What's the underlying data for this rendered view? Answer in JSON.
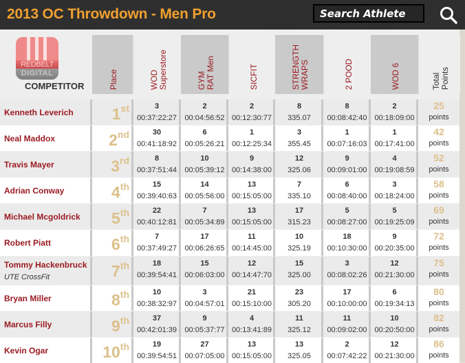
{
  "header": {
    "title": "2013 OC Throwdown - Men Pro",
    "search_placeholder": "Search Athlete",
    "search_icon": "magnifier-icon"
  },
  "logo": {
    "top_text": "REDBELT",
    "bottom_text": "DIGITAL",
    "label": "COMPETITOR"
  },
  "colors": {
    "title": "#f0a030",
    "athlete_name": "#9b1b22",
    "place_and_points": "#dcc08a"
  },
  "columns": [
    {
      "key": "place",
      "label": "Place"
    },
    {
      "key": "wod_superstore",
      "label": "WOD\nSuperstore"
    },
    {
      "key": "gym_rat_men",
      "label": "GYM\nRAT Men"
    },
    {
      "key": "sicfit",
      "label": "SICFIT"
    },
    {
      "key": "strength_wraps",
      "label": "STRENGTH\nWRAPS"
    },
    {
      "key": "two_pood",
      "label": "2 POOD"
    },
    {
      "key": "wod6",
      "label": "WOD 6"
    },
    {
      "key": "total",
      "label": "Total\nPoints"
    }
  ],
  "points_label": "points",
  "athletes": [
    {
      "name": "Kenneth Leverich",
      "affiliate": "",
      "place": "1",
      "suffix": "st",
      "events": [
        [
          "3",
          "00:37:22:27"
        ],
        [
          "2",
          "00:04:56:52"
        ],
        [
          "2",
          "00:12:30:77"
        ],
        [
          "8",
          "335.07"
        ],
        [
          "8",
          "00:08:42:40"
        ],
        [
          "2",
          "00:18:09:00"
        ]
      ],
      "total": "25"
    },
    {
      "name": "Neal Maddox",
      "affiliate": "",
      "place": "2",
      "suffix": "nd",
      "events": [
        [
          "30",
          "00:41:18:92"
        ],
        [
          "6",
          "00:05:26:21"
        ],
        [
          "1",
          "00:12:25:34"
        ],
        [
          "3",
          "355.45"
        ],
        [
          "1",
          "00:07:16:03"
        ],
        [
          "1",
          "00:17:41:00"
        ]
      ],
      "total": "42"
    },
    {
      "name": "Travis Mayer",
      "affiliate": "",
      "place": "3",
      "suffix": "rd",
      "events": [
        [
          "8",
          "00:37:51:44"
        ],
        [
          "10",
          "00:05:39:12"
        ],
        [
          "9",
          "00:14:38:00"
        ],
        [
          "12",
          "325.06"
        ],
        [
          "9",
          "00:09:01:00"
        ],
        [
          "4",
          "00:19:08:59"
        ]
      ],
      "total": "52"
    },
    {
      "name": "Adrian Conway",
      "affiliate": "",
      "place": "4",
      "suffix": "th",
      "events": [
        [
          "15",
          "00:39:40:63"
        ],
        [
          "14",
          "00:05:56:00"
        ],
        [
          "13",
          "00:15:05:00"
        ],
        [
          "7",
          "335.10"
        ],
        [
          "6",
          "00:08:40:00"
        ],
        [
          "3",
          "00:18:24:00"
        ]
      ],
      "total": "58"
    },
    {
      "name": "Michael Mcgoldrick",
      "affiliate": "",
      "place": "5",
      "suffix": "th",
      "events": [
        [
          "22",
          "00:40:12:81"
        ],
        [
          "7",
          "00:05:34:89"
        ],
        [
          "13",
          "00:15:05:00"
        ],
        [
          "17",
          "315.23"
        ],
        [
          "5",
          "00:08:27:00"
        ],
        [
          "5",
          "00:19:25:09"
        ]
      ],
      "total": "69"
    },
    {
      "name": "Robert Piatt",
      "affiliate": "",
      "place": "6",
      "suffix": "th",
      "events": [
        [
          "7",
          "00:37:49:27"
        ],
        [
          "17",
          "00:06:26:65"
        ],
        [
          "11",
          "00:14:45:00"
        ],
        [
          "10",
          "325.19"
        ],
        [
          "18",
          "00:10:30:00"
        ],
        [
          "9",
          "00:20:35:00"
        ]
      ],
      "total": "72"
    },
    {
      "name": "Tommy Hackenbruck",
      "affiliate": "UTE CrossFit",
      "place": "7",
      "suffix": "th",
      "events": [
        [
          "18",
          "00:39:54:41"
        ],
        [
          "15",
          "00:06:03:00"
        ],
        [
          "12",
          "00:14:47:70"
        ],
        [
          "15",
          "325.00"
        ],
        [
          "3",
          "00:08:02:26"
        ],
        [
          "12",
          "00:21:30:00"
        ]
      ],
      "total": "75"
    },
    {
      "name": "Bryan Miller",
      "affiliate": "",
      "place": "8",
      "suffix": "th",
      "events": [
        [
          "10",
          "00:38:32:97"
        ],
        [
          "3",
          "00:04:57:01"
        ],
        [
          "21",
          "00:15:10:00"
        ],
        [
          "23",
          "305.20"
        ],
        [
          "17",
          "00:10:00:00"
        ],
        [
          "6",
          "00:19:34:13"
        ]
      ],
      "total": "80"
    },
    {
      "name": "Marcus Filly",
      "affiliate": "",
      "place": "9",
      "suffix": "th",
      "events": [
        [
          "37",
          "00:42:01:39"
        ],
        [
          "9",
          "00:05:37:77"
        ],
        [
          "4",
          "00:13:41:89"
        ],
        [
          "11",
          "325.12"
        ],
        [
          "11",
          "00:09:02:00"
        ],
        [
          "10",
          "00:20:50:00"
        ]
      ],
      "total": "82"
    },
    {
      "name": "Kevin Ogar",
      "affiliate": "",
      "place": "10",
      "suffix": "th",
      "events": [
        [
          "19",
          "00:39:54:51"
        ],
        [
          "27",
          "00:07:05:00"
        ],
        [
          "13",
          "00:15:05:00"
        ],
        [
          "13",
          "325.05"
        ],
        [
          "2",
          "00:07:42:22"
        ],
        [
          "12",
          "00:21:30:00"
        ]
      ],
      "total": "86"
    }
  ]
}
